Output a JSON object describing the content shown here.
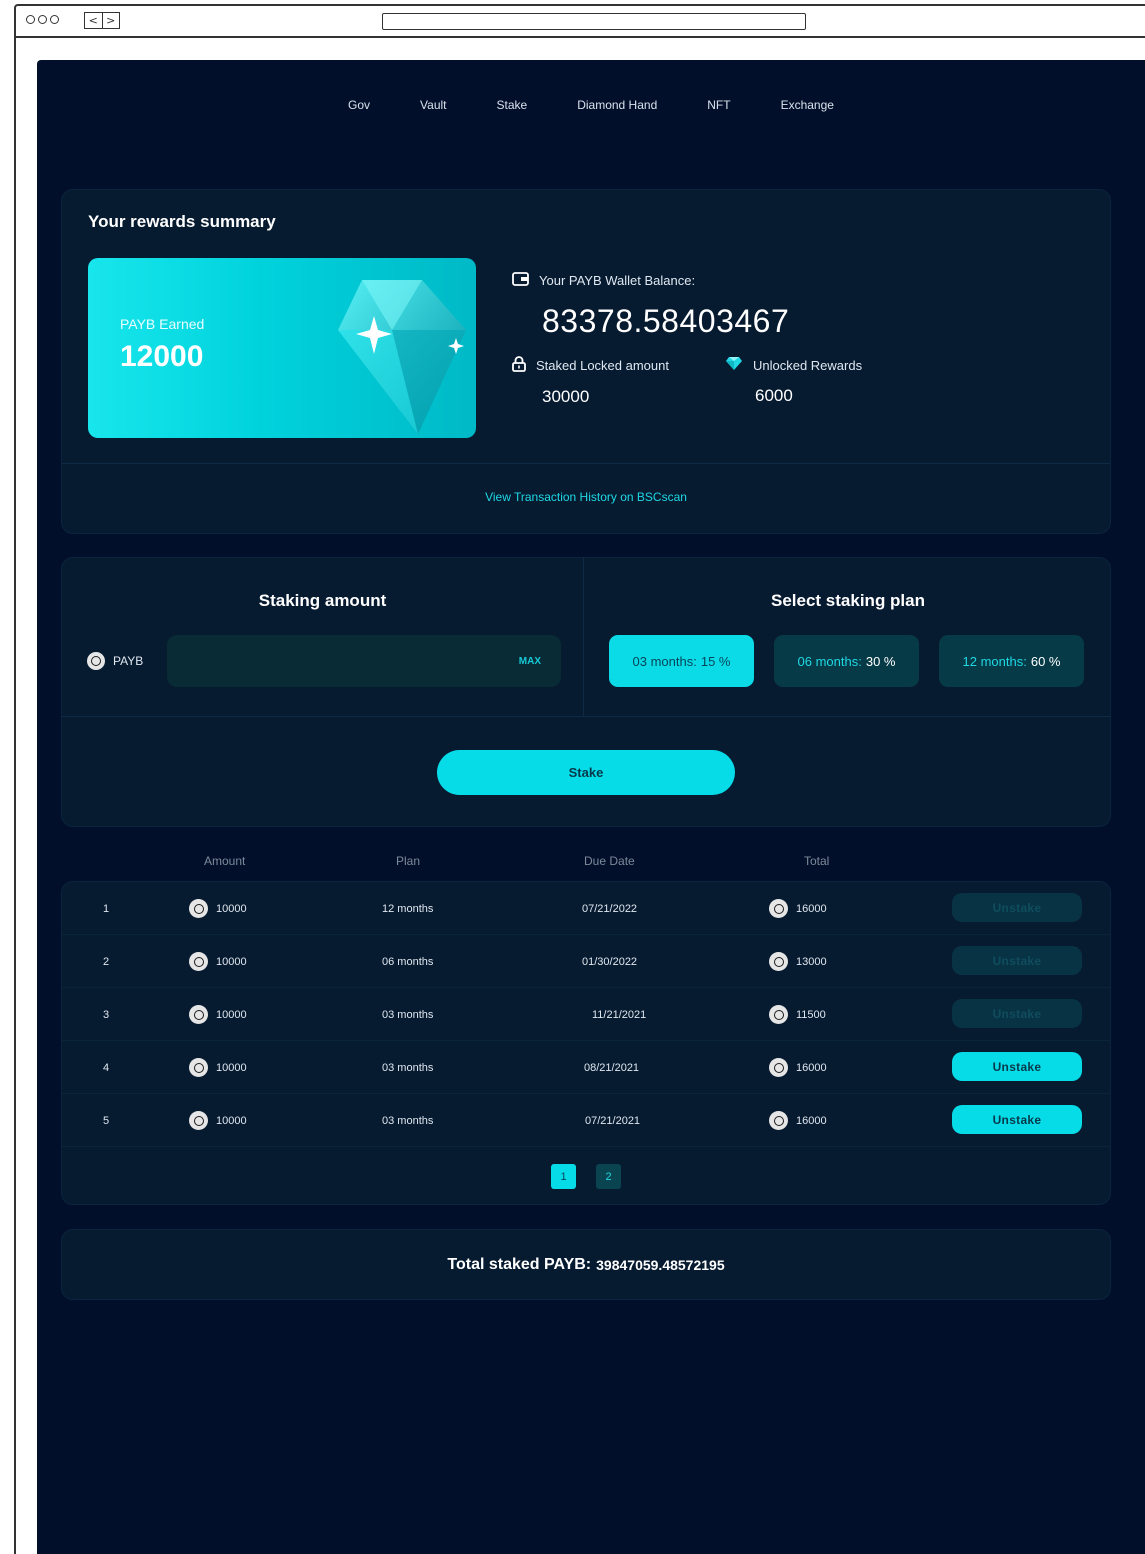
{
  "nav": [
    "Gov",
    "Vault",
    "Stake",
    "Diamond Hand",
    "NFT",
    "Exchange"
  ],
  "summary": {
    "title": "Your rewards summary",
    "card_label": "PAYB Earned",
    "card_value": "12000",
    "wallet_label": "Your PAYB Wallet Balance:",
    "wallet_value": "83378.58403467",
    "locked_label": "Staked Locked amount",
    "locked_value": "30000",
    "unlocked_label": "Unlocked Rewards",
    "unlocked_value": "6000",
    "history_link": "View Transaction History on BSCscan"
  },
  "staking": {
    "amount_title": "Staking amount",
    "token": "PAYB",
    "max_label": "MAX",
    "amount_value": "",
    "plan_title": "Select staking plan",
    "plans": [
      {
        "label": "03 months:",
        "rate": "15 %",
        "active": true
      },
      {
        "label": "06 months:",
        "rate": "30 %",
        "active": false
      },
      {
        "label": "12 months:",
        "rate": "60 %",
        "active": false
      }
    ],
    "stake_button": "Stake"
  },
  "table": {
    "headers": {
      "amount": "Amount",
      "plan": "Plan",
      "due": "Due Date",
      "total": "Total"
    },
    "rows": [
      {
        "n": "1",
        "amount": "10000",
        "plan": "12 months",
        "due": "07/21/2022",
        "total": "16000",
        "action": "Unstake",
        "enabled": false
      },
      {
        "n": "2",
        "amount": "10000",
        "plan": "06 months",
        "due": "01/30/2022",
        "total": "13000",
        "action": "Unstake",
        "enabled": false
      },
      {
        "n": "3",
        "amount": "10000",
        "plan": "03 months",
        "due": "11/21/2021",
        "total": "11500",
        "action": "Unstake",
        "enabled": false
      },
      {
        "n": "4",
        "amount": "10000",
        "plan": "03 months",
        "due": "08/21/2021",
        "total": "16000",
        "action": "Unstake",
        "enabled": true
      },
      {
        "n": "5",
        "amount": "10000",
        "plan": "03 months",
        "due": "07/21/2021",
        "total": "16000",
        "action": "Unstake",
        "enabled": true
      }
    ],
    "pages": [
      "1",
      "2"
    ],
    "current_page": "1"
  },
  "total": {
    "label": "Total staked PAYB:",
    "value": "39847059.48572195"
  },
  "colors": {
    "background": "#020f2a",
    "panel": "#061a30",
    "accent": "#05dce8"
  },
  "icons": {
    "wallet": "wallet-icon",
    "lock": "lock-icon",
    "diamond": "diamond-icon",
    "coin": "payb-coin-icon"
  }
}
